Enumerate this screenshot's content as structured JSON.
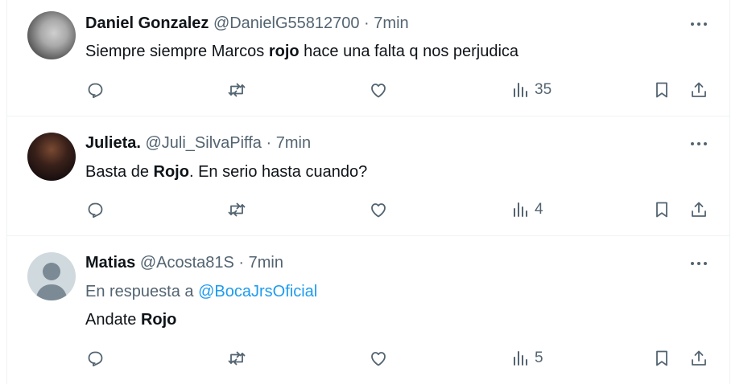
{
  "tweets": [
    {
      "name": "Daniel Gonzalez",
      "handle": "@DanielG55812700",
      "sep": "·",
      "time": "7min",
      "reply_prefix": "",
      "reply_mention": "",
      "body_before": "Siempre siempre Marcos ",
      "body_bold": "rojo",
      "body_after": " hace una falta q nos perjudica",
      "views": "35"
    },
    {
      "name": "Julieta.",
      "handle": "@Juli_SilvaPiffa",
      "sep": "·",
      "time": "7min",
      "reply_prefix": "",
      "reply_mention": "",
      "body_before": "Basta de ",
      "body_bold": "Rojo",
      "body_after": ". En serio hasta cuando?",
      "views": "4"
    },
    {
      "name": "Matias",
      "handle": "@Acosta81S",
      "sep": "·",
      "time": "7min",
      "reply_prefix": "En respuesta a ",
      "reply_mention": "@BocaJrsOficial",
      "body_before": "Andate ",
      "body_bold": "Rojo",
      "body_after": "",
      "views": "5"
    }
  ],
  "icons": {
    "reply": "reply-icon",
    "retweet": "retweet-icon",
    "like": "heart-icon",
    "views": "views-chart-icon",
    "bookmark": "bookmark-icon",
    "share": "share-icon",
    "more": "more-dots-icon"
  },
  "colors": {
    "text": "#0f1419",
    "secondary": "#536471",
    "link": "#1d9bf0",
    "divider": "#eff3f4"
  }
}
